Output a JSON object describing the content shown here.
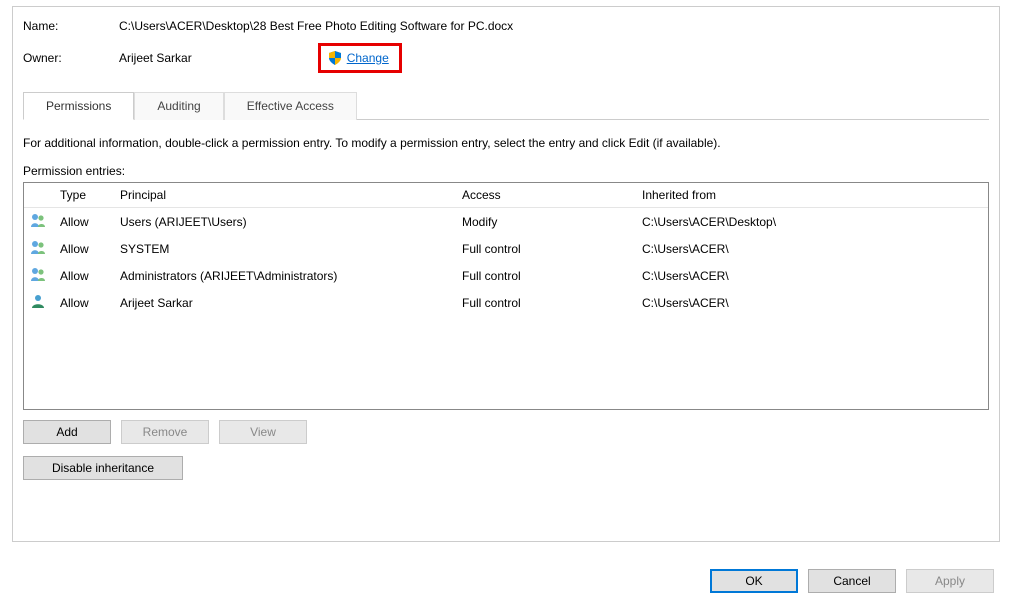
{
  "labels": {
    "name": "Name:",
    "owner": "Owner:",
    "change": "Change",
    "instructions": "For additional information, double-click a permission entry. To modify a permission entry, select the entry and click Edit (if available).",
    "entries_label": "Permission entries:",
    "add": "Add",
    "remove": "Remove",
    "view": "View",
    "disable_inheritance": "Disable inheritance",
    "ok": "OK",
    "cancel": "Cancel",
    "apply": "Apply"
  },
  "name_value": "C:\\Users\\ACER\\Desktop\\28 Best Free Photo Editing Software for PC.docx",
  "owner_value": "Arijeet Sarkar",
  "tabs": {
    "permissions": "Permissions",
    "auditing": "Auditing",
    "effective": "Effective Access"
  },
  "columns": {
    "type": "Type",
    "principal": "Principal",
    "access": "Access",
    "inherited": "Inherited from"
  },
  "entries": [
    {
      "icon": "group",
      "type": "Allow",
      "principal": "Users (ARIJEET\\Users)",
      "access": "Modify",
      "inherited": "C:\\Users\\ACER\\Desktop\\"
    },
    {
      "icon": "group",
      "type": "Allow",
      "principal": "SYSTEM",
      "access": "Full control",
      "inherited": "C:\\Users\\ACER\\"
    },
    {
      "icon": "group",
      "type": "Allow",
      "principal": "Administrators (ARIJEET\\Administrators)",
      "access": "Full control",
      "inherited": "C:\\Users\\ACER\\"
    },
    {
      "icon": "user",
      "type": "Allow",
      "principal": "Arijeet Sarkar",
      "access": "Full control",
      "inherited": "C:\\Users\\ACER\\"
    }
  ]
}
